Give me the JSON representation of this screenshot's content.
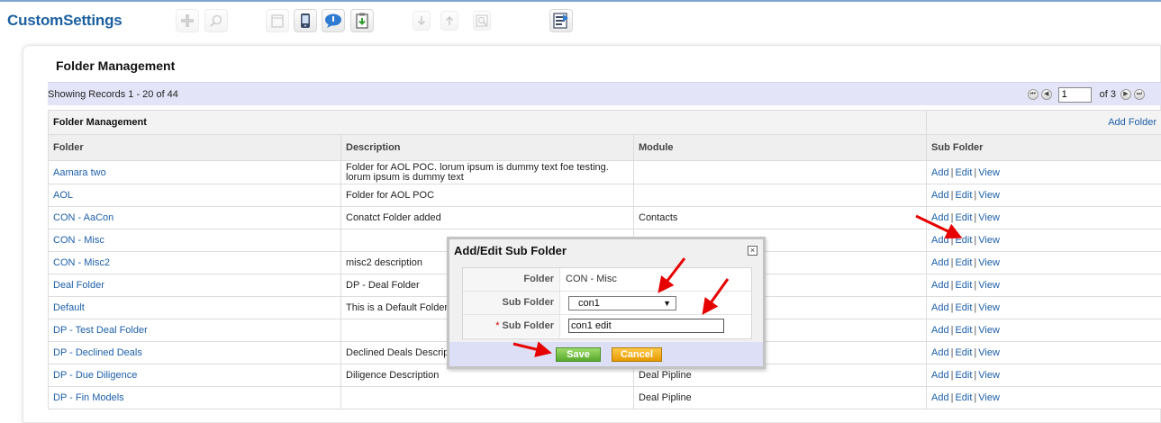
{
  "app": {
    "title": "CustomSettings"
  },
  "page": {
    "title": "Folder Management"
  },
  "records": {
    "label": "Showing Records 1 - 20 of 44"
  },
  "pager": {
    "current": "1",
    "of_label": "of 3"
  },
  "table": {
    "section_title": "Folder Management",
    "add_folder": "Add Folder",
    "columns": {
      "folder": "Folder",
      "description": "Description",
      "module": "Module",
      "subfolder": "Sub Folder"
    },
    "rows": [
      {
        "folder": "Aamara two",
        "description": "Folder for AOL POC. lorum ipsum is dummy text foe testing. lorum ipsum is dummy text",
        "module": ""
      },
      {
        "folder": "AOL",
        "description": "Folder for AOL POC",
        "module": ""
      },
      {
        "folder": "CON - AaCon",
        "description": "Conatct Folder added",
        "module": "Contacts"
      },
      {
        "folder": "CON - Misc",
        "description": "",
        "module": ""
      },
      {
        "folder": "CON - Misc2",
        "description": "misc2 description",
        "module": ""
      },
      {
        "folder": "Deal Folder",
        "description": "DP - Deal Folder",
        "module": ""
      },
      {
        "folder": "Default",
        "description": "This is a Default Folder",
        "module": ""
      },
      {
        "folder": "DP - Test Deal Folder",
        "description": "",
        "module": ""
      },
      {
        "folder": "DP - Declined Deals",
        "description": "Declined Deals Description",
        "module": ""
      },
      {
        "folder": "DP - Due Diligence",
        "description": "Diligence Description",
        "module": "Deal Pipline"
      },
      {
        "folder": "DP - Fin Models",
        "description": "",
        "module": "Deal Pipline"
      }
    ],
    "actions": {
      "add": "Add",
      "edit": "Edit",
      "view": "View",
      "separator": "|"
    }
  },
  "dialog": {
    "title": "Add/Edit Sub Folder",
    "close": "×",
    "folder_label": "Folder",
    "folder_value": "CON - Misc",
    "subfolder_label": "Sub Folder",
    "subfolder_selected": "con1",
    "subfolder_new_label": "Sub Folder",
    "required_mark": "*",
    "subfolder_new_value": "con1 edit",
    "save_label": "Save",
    "cancel_label": "Cancel"
  },
  "colors": {
    "brand_blue": "#1b5f9f",
    "link": "#1d5fa8",
    "records_bar": "#e3e4f7",
    "save_green": "#58a92c",
    "cancel_orange": "#e59a00",
    "annotation_red": "#e60000"
  },
  "icons": [
    "add-icon",
    "search-icon",
    "calendar-icon",
    "mobile-icon",
    "chat-icon",
    "clipboard-download-icon",
    "arrow-down-icon",
    "arrow-up-icon",
    "preview-icon",
    "report-icon"
  ]
}
